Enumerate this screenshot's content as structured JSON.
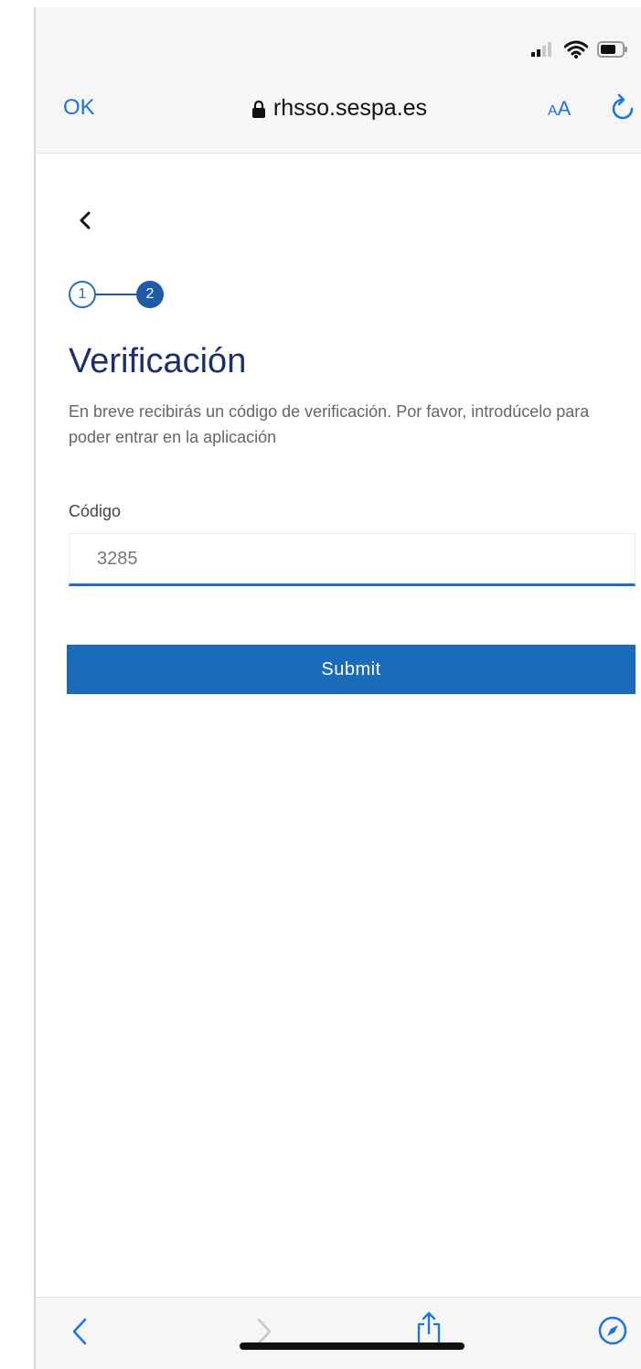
{
  "browser": {
    "done_label": "OK",
    "url": "rhsso.sespa.es",
    "text_size_small": "A",
    "text_size_large": "A"
  },
  "colors": {
    "accent": "#1a73e8",
    "brand": "#1a6bb8",
    "title": "#1b2f6e"
  },
  "icons": {
    "status": [
      "signal-icon",
      "wifi-icon",
      "battery-icon"
    ],
    "toolbar": [
      "chevron-left-icon",
      "chevron-right-icon",
      "share-icon",
      "compass-icon"
    ]
  },
  "stepper": {
    "steps": [
      "1",
      "2"
    ],
    "current": 2
  },
  "page": {
    "title": "Verificación",
    "description": "En breve recibirás un código de verificación. Por favor, introdúcelo para poder entrar en la aplicación"
  },
  "form": {
    "code_label": "Código",
    "code_value": "3285",
    "submit_label": "Submit"
  }
}
